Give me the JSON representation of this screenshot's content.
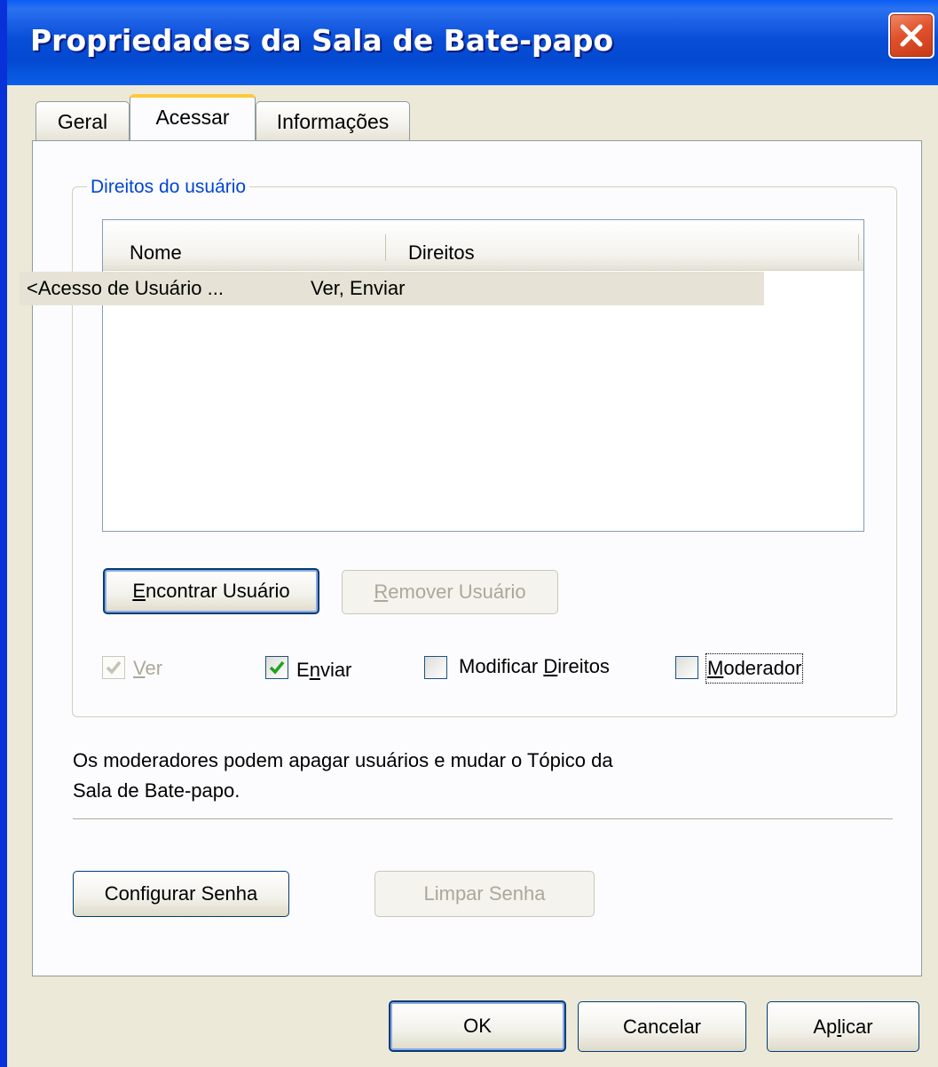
{
  "window": {
    "title": "Propriedades da Sala de Bate-papo",
    "close_icon": "close-icon"
  },
  "tabs": [
    {
      "label": "Geral",
      "active": false
    },
    {
      "label": "Acessar",
      "active": true
    },
    {
      "label": "Informações",
      "active": false
    }
  ],
  "user_rights": {
    "group_label": "Direitos do usuário",
    "columns": [
      "Nome",
      "Direitos"
    ],
    "rows": [
      {
        "name": "<Acesso de Usuário ...",
        "rights": "Ver, Enviar",
        "selected": true
      }
    ]
  },
  "user_buttons": {
    "find": {
      "pre": "",
      "key": "E",
      "post": "ncontrar Usuário",
      "enabled": true
    },
    "remove": {
      "pre": "",
      "key": "R",
      "post": "emover Usuário",
      "enabled": false
    }
  },
  "permissions": {
    "view": {
      "pre": "",
      "key": "V",
      "post": "er",
      "checked": true,
      "enabled": false
    },
    "send": {
      "pre": "E",
      "key": "n",
      "post": "viar",
      "checked": true,
      "enabled": true
    },
    "modify": {
      "pre": "Modificar ",
      "key": "D",
      "post": "ireitos",
      "checked": false,
      "enabled": true
    },
    "moderator": {
      "pre": "",
      "key": "M",
      "post": "oderador",
      "checked": false,
      "enabled": true
    }
  },
  "description": {
    "line1": "Os moderadores podem apagar usuários e mudar o Tópico da",
    "line2": "Sala de Bate-papo."
  },
  "password_buttons": {
    "set": "Configurar Senha",
    "clear": "Limpar Senha",
    "clear_enabled": false
  },
  "dialog_buttons": {
    "ok": "OK",
    "cancel": "Cancelar",
    "apply": {
      "pre": "Ap",
      "key": "l",
      "post": "icar"
    }
  },
  "colors": {
    "titlebar": "#0a4ed8",
    "dialog_face": "#ece9d8",
    "tab_highlight": "#ffc83c",
    "group_label": "#0046d5",
    "selected_row": "#e6e3d6",
    "close_button": "#e0512b",
    "check_mark": "#21a121"
  }
}
